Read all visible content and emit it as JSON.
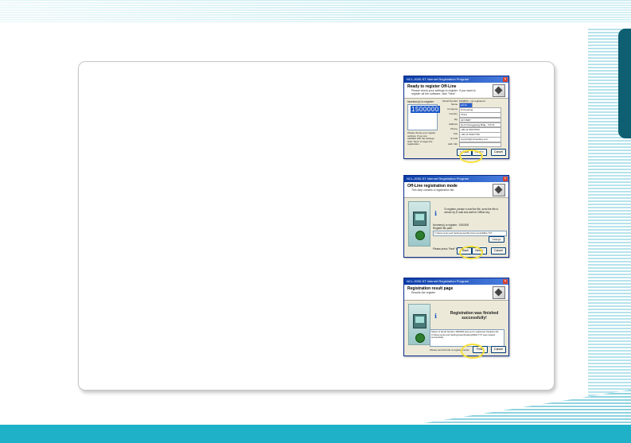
{
  "dialogs": [
    {
      "title": "NCL-2000-ST Internet Registration Program",
      "header_title": "Ready to register Off-Line",
      "header_sub": "Please check your settings to register. If you want to register all the software, click \"Next\".",
      "number_label": "Number(s) to register",
      "number_value": "1500000",
      "side_text": "Please check your register settings. If you are satisfied with the settings, click \"Next\" to begin the registration.",
      "serial_line": "Serial Number: 1500000 - not registered",
      "fields": [
        {
          "label": "Name",
          "value": "admin"
        },
        {
          "label": "Company",
          "value": "Proceeding"
        },
        {
          "label": "Country",
          "value": "China"
        },
        {
          "label": "Zip",
          "value": "437-5987"
        },
        {
          "label": "Address",
          "value": "No.8 Chengguang Bldg., 743 St"
        },
        {
          "label": "Phone",
          "value": "+86-21-56479752"
        },
        {
          "label": "Fax",
          "value": "+86-21-56227796"
        },
        {
          "label": "E-mail",
          "value": "support@proceeding.com"
        },
        {
          "label": "Add. Info",
          "value": ""
        }
      ],
      "buttons": {
        "back": "< Back",
        "next": "Next >",
        "cancel": "Cancel"
      }
    },
    {
      "title": "NCL-2000-ST Internet Registration Program",
      "header_title": "Off-Line registration mode",
      "header_sub": "This step creates a registration file.",
      "info_text": "To register, please e-mail the file, send the file to vendor by E-mail and wait for Offline key.",
      "reg_label": "Number(s) to register : 1500000",
      "reg_file_label": "Register file path:",
      "reg_path": "C:\\Documents and Settings\\user\\My Documents\\REG.TXT",
      "change_label": "Change",
      "press_text": "Please press \"Next\" to create file.",
      "buttons": {
        "back": "< Back",
        "next": "Next >",
        "cancel": "Cancel"
      }
    },
    {
      "title": "NCL-2000-ST Internet Registration Program",
      "header_title": "Registration result page",
      "header_sub": "Results the register",
      "big_text": "Registration was finished successfully!",
      "result_text": "Status of Serial Number 1500000 was set to registered. Register file: C:\\Documents and Settings\\user\\Desktop\\REG.TXT was created successfully.",
      "note_text": "Please send the file to register center.",
      "buttons": {
        "finish": "Finish",
        "cancel": "Cancel"
      }
    }
  ]
}
